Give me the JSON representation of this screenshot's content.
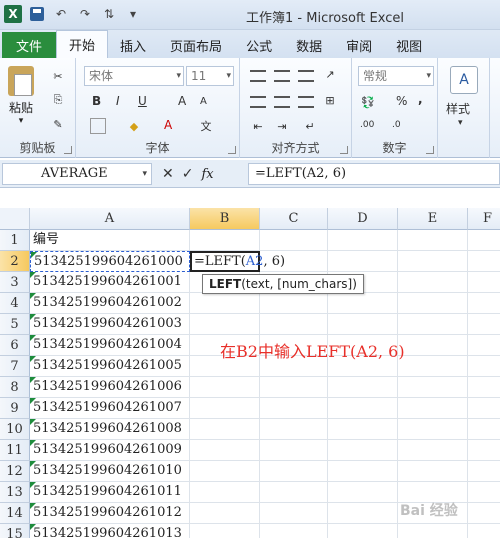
{
  "window": {
    "title": "工作簿1 - Microsoft Excel"
  },
  "ribbon": {
    "tabs": [
      {
        "label": "文件"
      },
      {
        "label": "开始"
      },
      {
        "label": "插入"
      },
      {
        "label": "页面布局"
      },
      {
        "label": "公式"
      },
      {
        "label": "数据"
      },
      {
        "label": "审阅"
      },
      {
        "label": "视图"
      }
    ],
    "groups": {
      "clipboard": "剪贴板",
      "font": "字体",
      "alignment": "对齐方式",
      "number": "数字"
    },
    "paste_label": "粘贴",
    "font_name": "宋体",
    "font_size": "11",
    "number_format": "常规",
    "styles_label": "样式",
    "bold": "B",
    "italic": "I",
    "underline": "U",
    "grow_font": "A",
    "shrink_font": "A",
    "percent": "%",
    "comma": ",",
    "inc_decimal": ".00",
    "dec_decimal": ".0"
  },
  "formula_bar": {
    "name_box": "AVERAGE",
    "fx": "fx",
    "formula": "=LEFT(A2, 6)"
  },
  "sheet": {
    "columns": [
      "A",
      "B",
      "C",
      "D",
      "E",
      "F"
    ],
    "active_cell_formula_prefix": "=LEFT(",
    "active_cell_ref": "A2",
    "active_cell_formula_suffix": ", 6)",
    "rows": [
      {
        "num": "1",
        "a": "编号"
      },
      {
        "num": "2",
        "a": "513425199604261000"
      },
      {
        "num": "3",
        "a": "513425199604261001"
      },
      {
        "num": "4",
        "a": "513425199604261002"
      },
      {
        "num": "5",
        "a": "513425199604261003"
      },
      {
        "num": "6",
        "a": "513425199604261004"
      },
      {
        "num": "7",
        "a": "513425199604261005"
      },
      {
        "num": "8",
        "a": "513425199604261006"
      },
      {
        "num": "9",
        "a": "513425199604261007"
      },
      {
        "num": "10",
        "a": "513425199604261008"
      },
      {
        "num": "11",
        "a": "513425199604261009"
      },
      {
        "num": "12",
        "a": "513425199604261010"
      },
      {
        "num": "13",
        "a": "513425199604261011"
      },
      {
        "num": "14",
        "a": "513425199604261012"
      },
      {
        "num": "15",
        "a": "513425199604261013"
      }
    ]
  },
  "tooltip": {
    "func": "LEFT",
    "args": "(text, [num_chars])"
  },
  "annotation": "在B2中输入LEFT(A2, 6)",
  "watermark": "Bai 经验",
  "colors": {
    "file_tab": "#2a8d3d",
    "annotation": "#e8302a",
    "reference": "#2d5fd0",
    "selected_header": "#f6c95f"
  }
}
